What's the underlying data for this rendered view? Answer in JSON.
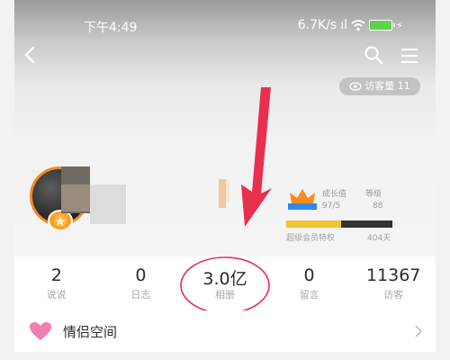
{
  "status_bar": {
    "time": "下午4:49",
    "network": "6.7K/s",
    "signal_text": "ıl",
    "battery_color": "#5dd24b"
  },
  "nav": {
    "back_icon": "chevron-left-icon",
    "search_icon": "search-icon",
    "menu_icon": "hamburger-menu-icon"
  },
  "visitor_badge": {
    "label": "访客量 11"
  },
  "profile": {
    "avatar_border_color": "#ef8a24"
  },
  "vip": {
    "col1": "成长值",
    "col2": "等级",
    "val1": "97/5",
    "val2": "88",
    "progress": 0.52,
    "foot_left": "超级会员特权",
    "foot_right": "404天"
  },
  "stats": [
    {
      "value": "2",
      "label": "说说"
    },
    {
      "value": "0",
      "label": "日志"
    },
    {
      "value": "3.0亿",
      "label": "相册"
    },
    {
      "value": "0",
      "label": "留言"
    },
    {
      "value": "11367",
      "label": "访客"
    }
  ],
  "highlight": {
    "color": "#e8304e",
    "target": "相册"
  },
  "couple": {
    "label": "情侣空间",
    "heart_color": "#f07fb4"
  }
}
